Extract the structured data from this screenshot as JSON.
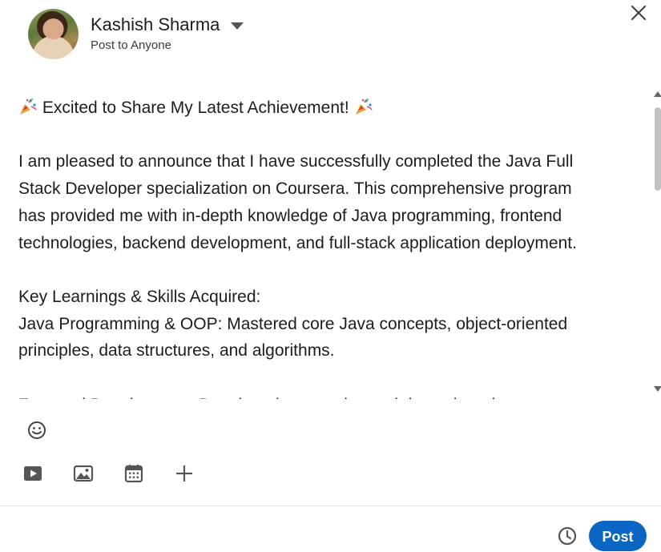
{
  "composer": {
    "author_name": "Kashish Sharma",
    "visibility": "Post to Anyone"
  },
  "post": {
    "lines": [
      "Excited to Share My Latest Achievement!",
      "",
      "I am pleased to announce that I have successfully completed the Java Full",
      "Stack Developer specialization on Coursera. This comprehensive program",
      "has provided me with in-depth knowledge of Java programming, frontend",
      "technologies, backend development, and full-stack application deployment.",
      "",
      "Key Learnings & Skills Acquired:",
      "Java Programming & OOP: Mastered core Java concepts, object-oriented",
      "principles, data structures, and algorithms.",
      "",
      "Frontend Development: Developed responsive and dynamic web"
    ],
    "headline_emoji": "party-popper-icon"
  },
  "toolbar": {
    "icons": [
      "emoji-icon",
      "video-icon",
      "photo-icon",
      "event-calendar-icon",
      "add-icon",
      "clock-icon"
    ]
  },
  "footer": {
    "post_label": "Post"
  },
  "colors": {
    "accent": "#0a66c2",
    "text": "#1d1d1d"
  }
}
